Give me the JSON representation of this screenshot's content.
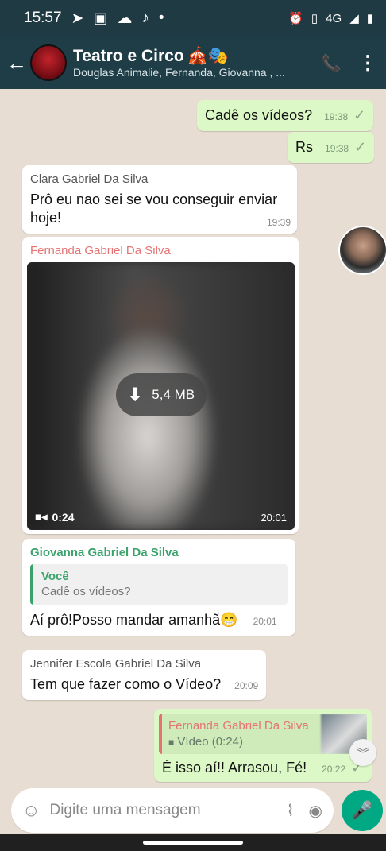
{
  "status_bar": {
    "time": "15:57",
    "network": "4G"
  },
  "header": {
    "title": "Teatro e Circo",
    "title_emoji": "🎪🎭",
    "subtitle": "Douglas Animalie, Fernanda, Giovanna , ..."
  },
  "messages": {
    "m1": {
      "text": "Cadê os vídeos?",
      "time": "19:38"
    },
    "m2": {
      "text": "Rs",
      "time": "19:38"
    },
    "m3": {
      "sender": "Clara Gabriel Da Silva",
      "text": "Prô eu nao sei se vou conseguir enviar hoje!",
      "time": "19:39"
    },
    "m4": {
      "sender": "Fernanda Gabriel Da Silva",
      "size": "5,4 MB",
      "duration": "0:24",
      "time": "20:01"
    },
    "m5": {
      "sender": "Giovanna Gabriel Da Silva",
      "quote_name": "Você",
      "quote_text": "Cadê os vídeos?",
      "text": "Aí prô!Posso mandar amanhã😁",
      "time": "20:01"
    },
    "m6": {
      "sender": "Jennifer Escola Gabriel Da Silva",
      "text": "Tem que fazer como o Vídeo?",
      "time": "20:09"
    },
    "m7": {
      "quote_name": "Fernanda Gabriel Da Silva",
      "quote_text": "Vídeo (0:24)",
      "text": "É isso aí!! Arrasou, Fé!",
      "time": "20:22"
    }
  },
  "composer": {
    "placeholder": "Digite uma mensagem"
  },
  "colors": {
    "header": "#1f3d47",
    "outgoing": "#dcf8c6",
    "accent": "#00a884"
  }
}
